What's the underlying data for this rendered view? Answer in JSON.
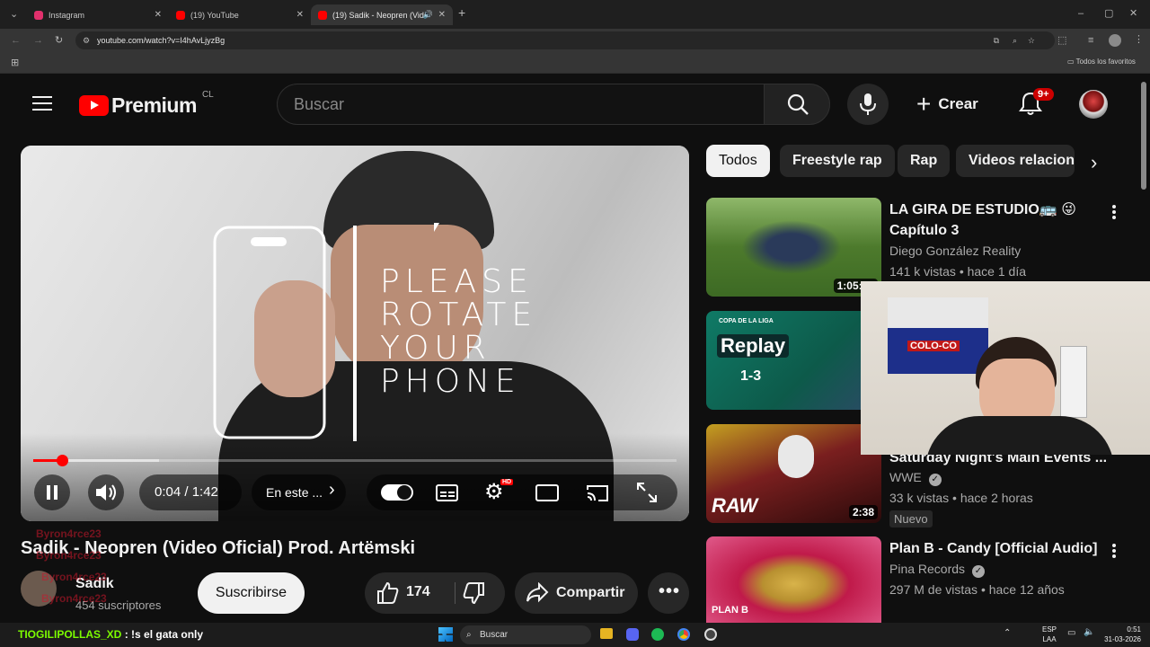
{
  "browser": {
    "tabs": [
      {
        "label": "Instagram",
        "color": "#e1306c"
      },
      {
        "label": "(19) YouTube",
        "color": "#ff0000"
      },
      {
        "label": "(19) Sadik - Neopren (Vide",
        "color": "#ff0000"
      }
    ],
    "url": "youtube.com/watch?v=I4hAvLjyzBg",
    "bookmarks_label": "Todos los favoritos"
  },
  "youtube": {
    "logo_text": "Premium",
    "country": "CL",
    "search_placeholder": "Buscar",
    "create_label": "Crear",
    "notif_count": "9+",
    "chips": [
      "Todos",
      "Freestyle rap",
      "Rap",
      "Videos relacion"
    ],
    "player": {
      "overlay_lines": [
        "PLEASE",
        "ROTATE",
        "YOUR",
        "PHONE"
      ],
      "time": "0:04 / 1:42",
      "chapter": "En este ...",
      "progress": 0.045,
      "settings_badge": "HD"
    },
    "video": {
      "title": "Sadik - Neopren (Video Oficial) Prod. Artëmski",
      "channel": "Sadik",
      "subscribers": "454 suscriptores",
      "subscribe_label": "Suscribirse",
      "likes": "174",
      "share_label": "Compartir"
    },
    "recs": [
      {
        "title": "LA GIRA DE ESTUDIO🚌 😜 Capítulo 3",
        "channel": "Diego González Reality",
        "meta": "141 k vistas • hace 1 día",
        "duration": "1:05:26",
        "thumb_color": "#4d7a2c"
      },
      {
        "title": "",
        "channel": "",
        "meta": "",
        "duration": "7:",
        "thumb_color": "#0d6a5a"
      },
      {
        "title": "Saturday Night's Main Events ...",
        "channel": "WWE",
        "meta": "33 k vistas • hace 2 horas",
        "badge": "Nuevo",
        "duration": "2:38",
        "thumb_color": "#7a1f1f"
      },
      {
        "title": "Plan B - Candy [Official Audio]",
        "channel": "Pina Records",
        "meta": "297 M de vistas • hace 12 años",
        "duration": "",
        "thumb_color": "#9a1436"
      }
    ],
    "rec2_thumb_text": "Replay",
    "rec2_score": "1-3",
    "rec2_league": "COPA DE LA LIGA",
    "rec3_thumb_text": "RAW",
    "rec4_thumb_text": "PLAN B"
  },
  "stream_overlay": {
    "chat_user": "TIOGILIPOLLAS_XD",
    "chat_msg": ": !s el gata only",
    "chat_ghost": "Byron4rce23",
    "webcam_flag": "COLO-CO"
  },
  "taskbar": {
    "search_label": "Buscar",
    "lang_top": "ESP",
    "lang_bottom": "LAA",
    "clock_time": "0:51",
    "clock_date": "31-03-2026"
  }
}
